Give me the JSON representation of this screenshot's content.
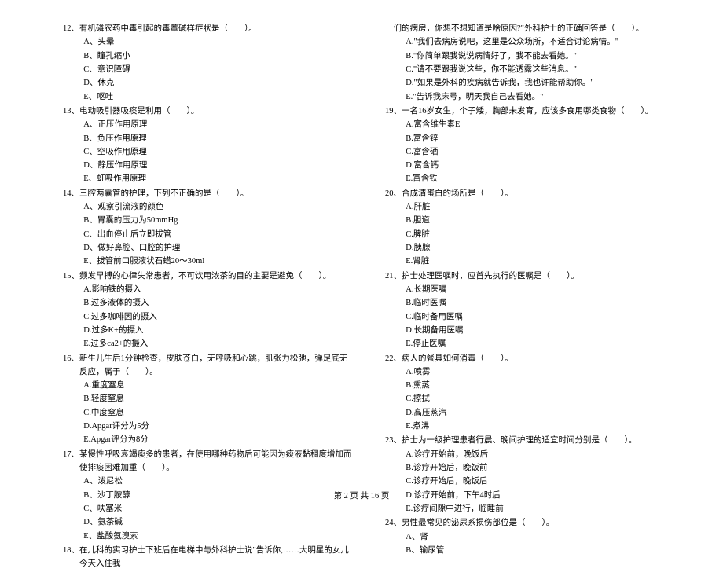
{
  "footer": "第 2 页 共 16 页",
  "left": {
    "q12": {
      "stem": "12、有机磷农药中毒引起的毒蕈碱样症状是（　　）。",
      "a": "A、头晕",
      "b": "B、瞳孔缩小",
      "c": "C、意识障碍",
      "d": "D、休克",
      "e": "E、呕吐"
    },
    "q13": {
      "stem": "13、电动吸引器吸痰是利用（　　）。",
      "a": "A、正压作用原理",
      "b": "B、负压作用原理",
      "c": "C、空吸作用原理",
      "d": "D、静压作用原理",
      "e": "E、虹吸作用原理"
    },
    "q14": {
      "stem": "14、三腔两囊管的护理，下列不正确的是（　　）。",
      "a": "A、观察引流液的颜色",
      "b": "B、胃囊的压力为50mmHg",
      "c": "C、出血停止后立即拔管",
      "d": "D、做好鼻腔、口腔的护理",
      "e": "E、拔管前口服液状石蜡20～30ml"
    },
    "q15": {
      "stem": "15、频发早搏的心律失常患者，不可饮用浓茶的目的主要是避免（　　）。",
      "a": "A.影响铁的摄入",
      "b": "B.过多液体的摄入",
      "c": "C.过多咖啡因的摄入",
      "d": "D.过多K+的摄入",
      "e": "E.过多ca2+的摄入"
    },
    "q16": {
      "stem": "16、新生儿生后1分钟检查，皮肤苍白，无呼吸和心跳，肌张力松弛，弹足底无反应，属于（　　）。",
      "a": "A.重度窒息",
      "b": "B.轻度窒息",
      "c": "C.中度窒息",
      "d": "D.Apgar评分为5分",
      "e": "E.Apgar评分为8分"
    },
    "q17": {
      "stem": "17、某慢性呼吸衰竭痰多的患者，在使用哪种药物后可能因为痰液黏稠度增加而使排痰困难加重（　　）。",
      "a": "A、泼尼松",
      "b": "B、沙丁胺醇",
      "c": "C、呋塞米",
      "d": "D、氨茶碱",
      "e": "E、盐酸氨溴索"
    },
    "q18": {
      "stem": "18、在儿科的实习护士下班后在电梯中与外科护士说\"告诉你,……大明星的女儿今天入住我"
    }
  },
  "right": {
    "q18cont": {
      "stem": "们的病房，你想不想知道是啥原因?\"外科护士的正确回答是（　　）。",
      "a": "A.\"我们去病房说吧，这里是公众场所，不适合讨论病情。\"",
      "b": "B.\"你简单跟我说说病情好了，我不能去看她。\"",
      "c": "C.\"请不要跟我说这些，你不能透露这些消息。\"",
      "d": "D.\"如果是外科的疾病就告诉我，我也许能帮助你。\"",
      "e": "E.\"告诉我床号，明天我自己去看她。\""
    },
    "q19": {
      "stem": "19、一名16岁女生，个子矮，胸部未发育，应该多食用哪类食物（　　）。",
      "a": "A.富含维生素E",
      "b": "B.富含锌",
      "c": "C.富含硒",
      "d": "D.富含钙",
      "e": "E.富含铁"
    },
    "q20": {
      "stem": "20、合成清蛋白的场所是（　　）。",
      "a": "A.肝脏",
      "b": "B.胆道",
      "c": "C.脾脏",
      "d": "D.胰腺",
      "e": "E.肾脏"
    },
    "q21": {
      "stem": "21、护士处理医嘱时，应首先执行的医嘱是（　　）。",
      "a": "A.长期医嘱",
      "b": "B.临时医嘱",
      "c": "C.临时备用医嘱",
      "d": "D.长期备用医嘱",
      "e": "E.停止医嘱"
    },
    "q22": {
      "stem": "22、病人的餐具如何消毒（　　）。",
      "a": "A.喷雾",
      "b": "B.熏蒸",
      "c": "C.擦拭",
      "d": "D.高压蒸汽",
      "e": "E.煮沸"
    },
    "q23": {
      "stem": "23、护士为一级护理患者行晨、晚间护理的适宜时间分别是（　　）。",
      "a": "A.诊疗开始前，晚饭后",
      "b": "B.诊疗开始后，晚饭前",
      "c": "C.诊疗开始后，晚饭后",
      "d": "D.诊疗开始前，下午4时后",
      "e": "E.诊疗间隙中进行，临睡前"
    },
    "q24": {
      "stem": "24、男性最常见的泌尿系损伤部位是（　　）。",
      "a": "A、肾",
      "b": "B、输尿管"
    }
  }
}
